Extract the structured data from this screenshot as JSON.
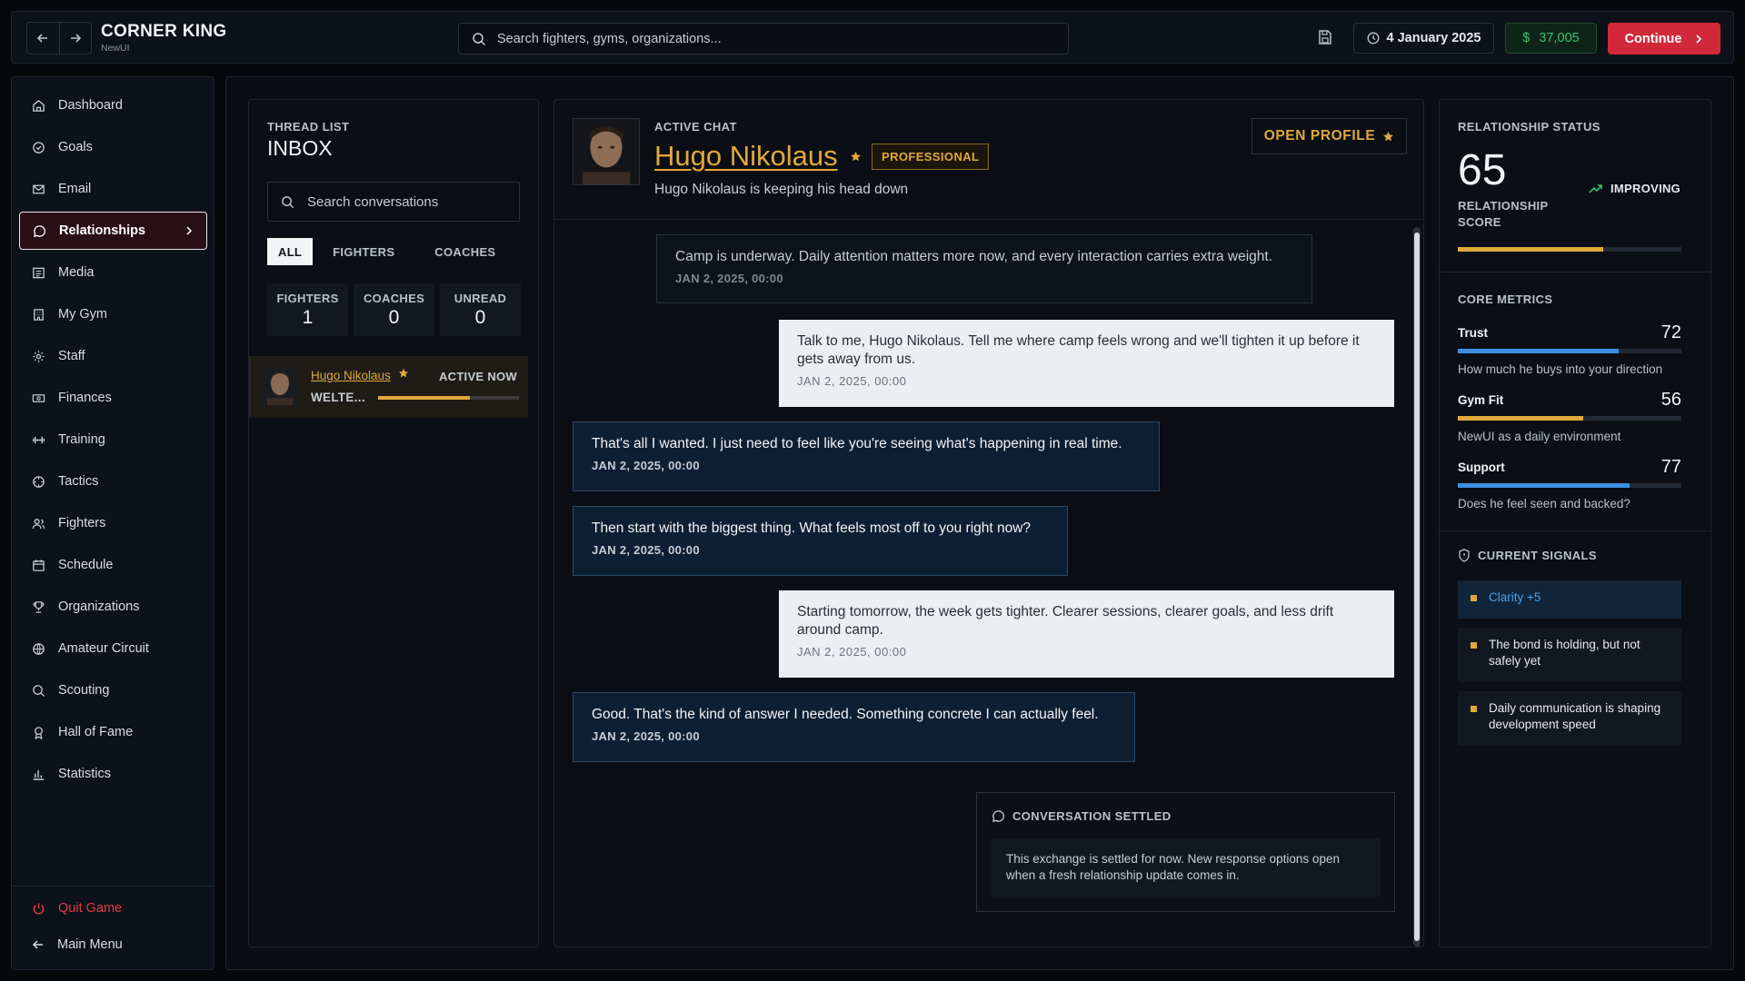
{
  "app": {
    "title": "CORNER KING",
    "subtitle": "NewUI"
  },
  "topbar": {
    "search_placeholder": "Search fighters, gyms, organizations...",
    "date": "4 January 2025",
    "money": "$37,005",
    "money_symbol": "$",
    "continue_label": "Continue"
  },
  "sidebar": {
    "items": [
      {
        "label": "Dashboard",
        "icon": "home-icon"
      },
      {
        "label": "Goals",
        "icon": "check-circle-icon"
      },
      {
        "label": "Email",
        "icon": "mail-icon"
      },
      {
        "label": "Relationships",
        "icon": "chat-bubble-icon",
        "active": true
      },
      {
        "label": "Media",
        "icon": "newspaper-icon"
      },
      {
        "label": "My Gym",
        "icon": "building-icon"
      },
      {
        "label": "Staff",
        "icon": "gear-icon"
      },
      {
        "label": "Finances",
        "icon": "banknote-icon"
      },
      {
        "label": "Training",
        "icon": "dumbbell-icon"
      },
      {
        "label": "Tactics",
        "icon": "target-icon"
      },
      {
        "label": "Fighters",
        "icon": "users-icon"
      },
      {
        "label": "Schedule",
        "icon": "calendar-icon"
      },
      {
        "label": "Organizations",
        "icon": "trophy-icon"
      },
      {
        "label": "Amateur Circuit",
        "icon": "globe-icon"
      },
      {
        "label": "Scouting",
        "icon": "search-icon"
      },
      {
        "label": "Hall of Fame",
        "icon": "award-icon"
      },
      {
        "label": "Statistics",
        "icon": "bar-chart-icon"
      }
    ],
    "quit_label": "Quit Game",
    "main_menu_label": "Main Menu"
  },
  "inbox": {
    "caption": "THREAD LIST",
    "title": "INBOX",
    "search_placeholder": "Search conversations",
    "filters": [
      "ALL",
      "FIGHTERS",
      "COACHES"
    ],
    "stats": [
      {
        "label": "FIGHTERS",
        "value": "1"
      },
      {
        "label": "COACHES",
        "value": "0"
      },
      {
        "label": "UNREAD",
        "value": "0"
      }
    ],
    "threads": [
      {
        "name": "Hugo Nikolaus",
        "status": "ACTIVE NOW",
        "weight_class": "WELTE...",
        "progress": 0.65
      }
    ]
  },
  "chat": {
    "caption": "ACTIVE CHAT",
    "name": "Hugo Nikolaus",
    "badge": "PROFESSIONAL",
    "subtitle": "Hugo Nikolaus is keeping his head down",
    "open_profile_label": "OPEN PROFILE",
    "messages": [
      {
        "type": "system",
        "text": "Camp is underway. Daily attention matters more now, and every interaction carries extra weight.",
        "time": "JAN 2, 2025, 00:00"
      },
      {
        "type": "out",
        "text": "Talk to me, Hugo Nikolaus. Tell me where camp feels wrong and we'll tighten it up before it gets away from us.",
        "time": "JAN 2, 2025, 00:00"
      },
      {
        "type": "in",
        "text": "That's all I wanted. I just need to feel like you're seeing what's happening in real time.",
        "time": "JAN 2, 2025, 00:00"
      },
      {
        "type": "in",
        "text": "Then start with the biggest thing. What feels most off to you right now?",
        "time": "JAN 2, 2025, 00:00"
      },
      {
        "type": "out",
        "text": "Starting tomorrow, the week gets tighter. Clearer sessions, clearer goals, and less drift around camp.",
        "time": "JAN 2, 2025, 00:00"
      },
      {
        "type": "in",
        "text": "Good. That's the kind of answer I needed. Something concrete I can actually feel.",
        "time": "JAN 2, 2025, 00:00"
      }
    ],
    "settled": {
      "title": "CONVERSATION SETTLED",
      "body": "This exchange is settled for now. New response options open when a fresh relationship update comes in."
    }
  },
  "relationship": {
    "caption": "RELATIONSHIP STATUS",
    "score": "65",
    "score_label_1": "RELATIONSHIP",
    "score_label_2": "SCORE",
    "score_fraction": 0.65,
    "trend": "IMPROVING",
    "metrics_caption": "CORE METRICS",
    "metrics": [
      {
        "name": "Trust",
        "value": "72",
        "desc": "How much he buys into your direction",
        "color": "#3a8fe0",
        "fraction": 0.72
      },
      {
        "name": "Gym Fit",
        "value": "56",
        "desc": "NewUI as a daily environment",
        "color": "#e0a93a",
        "fraction": 0.56
      },
      {
        "name": "Support",
        "value": "77",
        "desc": "Does he feel seen and backed?",
        "color": "#3a8fe0",
        "fraction": 0.77
      }
    ],
    "signals_caption": "CURRENT SIGNALS",
    "signals": [
      {
        "text": "Clarity +5",
        "highlight": true
      },
      {
        "text": "The bond is holding, but not safely yet",
        "highlight": false
      },
      {
        "text": "Daily communication is shaping development speed",
        "highlight": false
      }
    ]
  },
  "colors": {
    "accent_gold": "#e0a93a",
    "accent_red": "#d1283a",
    "accent_blue": "#3a8fe0",
    "money_green": "#36c26a"
  }
}
